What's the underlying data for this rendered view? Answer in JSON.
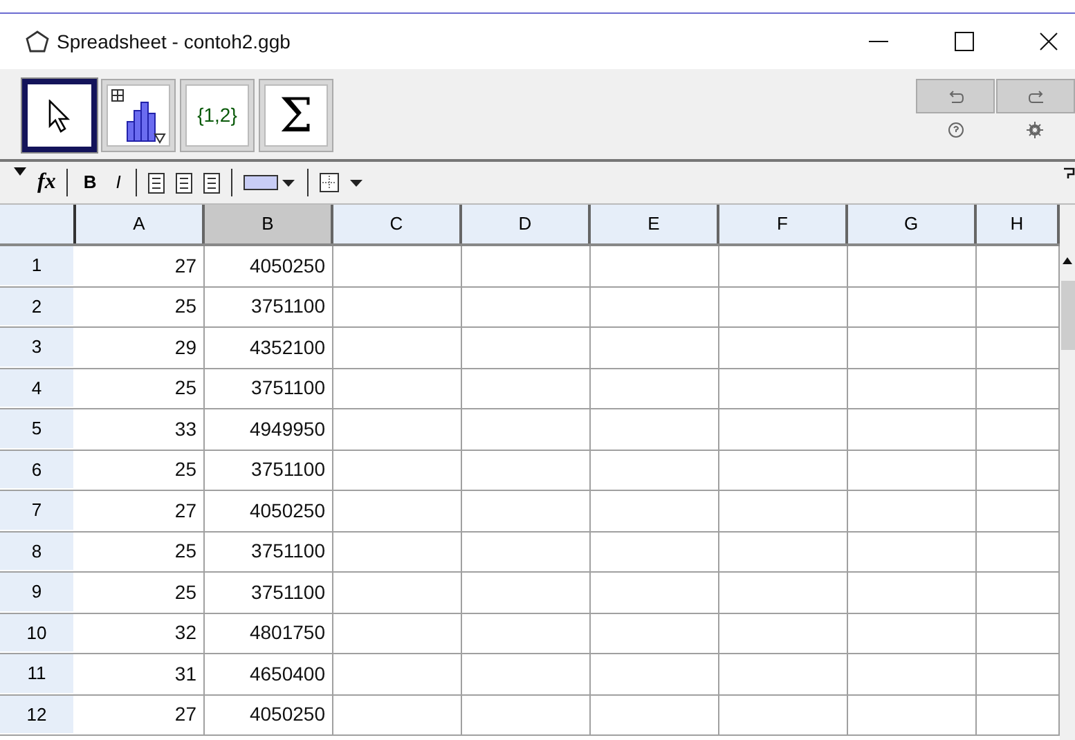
{
  "window": {
    "title": "Spreadsheet - contoh2.ggb"
  },
  "tools": [
    {
      "kind": "move",
      "selected": true
    },
    {
      "kind": "chart",
      "selected": false
    },
    {
      "kind": "list",
      "label": "{1,2}",
      "selected": false
    },
    {
      "kind": "sum",
      "label": "Σ",
      "selected": false
    }
  ],
  "format_bar": {
    "fx": "fx",
    "bold": "B",
    "italic": "I"
  },
  "columns": [
    {
      "label": "A",
      "selected": false
    },
    {
      "label": "B",
      "selected": true
    },
    {
      "label": "C",
      "selected": false
    },
    {
      "label": "D",
      "selected": false
    },
    {
      "label": "E",
      "selected": false
    },
    {
      "label": "F",
      "selected": false
    },
    {
      "label": "G",
      "selected": false
    },
    {
      "label": "H",
      "selected": false
    }
  ],
  "rows": [
    {
      "header": "1",
      "cells": [
        "27",
        "4050250"
      ]
    },
    {
      "header": "2",
      "cells": [
        "25",
        "3751100"
      ]
    },
    {
      "header": "3",
      "cells": [
        "29",
        "4352100"
      ]
    },
    {
      "header": "4",
      "cells": [
        "25",
        "3751100"
      ]
    },
    {
      "header": "5",
      "cells": [
        "33",
        "4949950"
      ]
    },
    {
      "header": "6",
      "cells": [
        "25",
        "3751100"
      ]
    },
    {
      "header": "7",
      "cells": [
        "27",
        "4050250"
      ]
    },
    {
      "header": "8",
      "cells": [
        "25",
        "3751100"
      ]
    },
    {
      "header": "9",
      "cells": [
        "25",
        "3751100"
      ]
    },
    {
      "header": "10",
      "cells": [
        "32",
        "4801750"
      ]
    },
    {
      "header": "11",
      "cells": [
        "31",
        "4650400"
      ]
    },
    {
      "header": "12",
      "cells": [
        "27",
        "4050250"
      ]
    }
  ]
}
